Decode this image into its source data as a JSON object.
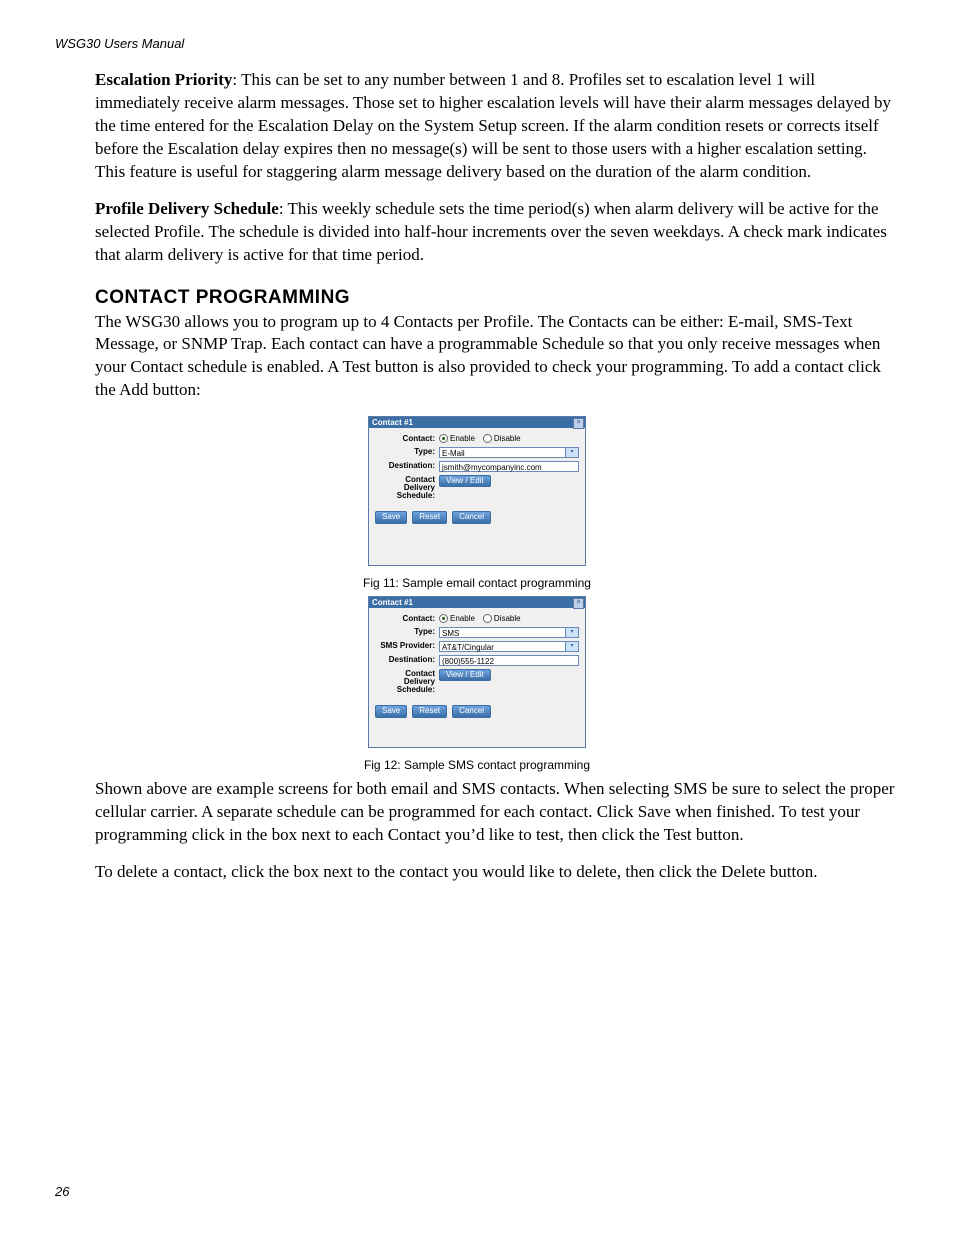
{
  "header": "WSG30 Users Manual",
  "para1_runin": "Escalation Priority",
  "para1": ": This can be set to any number between 1 and 8. Profiles set to escalation level 1 will immediately receive alarm messages. Those set to higher escalation levels will have their alarm messages delayed by the time entered for the Escalation Delay on the System Setup screen. If the alarm condition resets or corrects itself before the Escalation delay expires then no message(s) will be sent to those users with a higher escalation setting. This feature is useful for staggering alarm message delivery based on the duration of the alarm condition.",
  "para2_runin": "Profile Delivery Schedule",
  "para2": ": This weekly schedule sets the time period(s) when alarm delivery will be active for the selected Profile. The schedule is divided into half-hour increments over the seven weekdays. A check mark indicates that alarm delivery is active for that time period.",
  "section_heading": "CONTACT PROGRAMMING",
  "para3": "The WSG30 allows you to program up to 4 Contacts per Profile. The Contacts can be either: E-mail, SMS-Text Message, or SNMP Trap. Each contact can have a programmable Schedule so that you only receive messages when your Contact schedule is enabled. A Test button is also provided to check your programming. To add a contact click the Add button:",
  "fig11_caption": "Fig 11: Sample email contact programming",
  "fig12_caption": "Fig 12: Sample SMS contact programming",
  "dialog1": {
    "title": "Contact #1",
    "labels": {
      "contact": "Contact:",
      "type": "Type:",
      "destination": "Destination:",
      "schedule": "Contact Delivery Schedule:"
    },
    "radio_enable": "Enable",
    "radio_disable": "Disable",
    "type_value": "E-Mail",
    "dest_value": "jsmith@mycompanyinc.com",
    "view_edit": "View / Edit",
    "save": "Save",
    "reset": "Reset",
    "cancel": "Cancel"
  },
  "dialog2": {
    "title": "Contact #1",
    "labels": {
      "contact": "Contact:",
      "type": "Type:",
      "provider": "SMS Provider:",
      "destination": "Destination:",
      "schedule": "Contact Delivery Schedule:"
    },
    "radio_enable": "Enable",
    "radio_disable": "Disable",
    "type_value": "SMS",
    "provider_value": "AT&T/Cingular",
    "dest_value": "(800)555-1122",
    "view_edit": "View / Edit",
    "save": "Save",
    "reset": "Reset",
    "cancel": "Cancel"
  },
  "para4": "Shown above are example screens for both email and SMS contacts. When selecting SMS be sure to select the proper cellular carrier. A separate schedule can be programmed for each contact. Click Save when finished. To test your programming click in the box next to each Contact you’d like to test, then click the Test button.",
  "para5": "To delete a contact, click the box next to the contact you would like to delete, then click the Delete button.",
  "page_number": "26"
}
